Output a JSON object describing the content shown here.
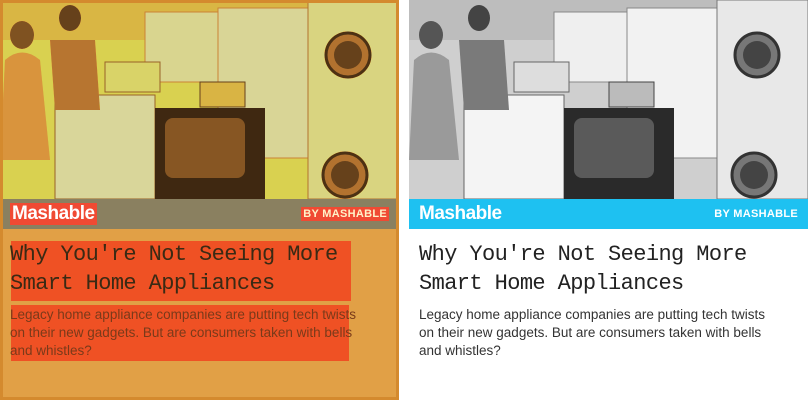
{
  "article": {
    "brand": "Mashable",
    "byline": "BY MASHABLE",
    "headline": "Why You're Not Seeing More Smart Home Appliances",
    "summary": "Legacy home appliance companies are putting tech twists on their new gadgets. But are consumers taken with bells and whistles?",
    "image_description": "vintage photo of a couple viewing stoves, a television, washers and dryers"
  },
  "colors": {
    "brand_bar": "#1ec1f1",
    "highlight": "#f04a22",
    "overlay_tint": "#e1a046"
  }
}
